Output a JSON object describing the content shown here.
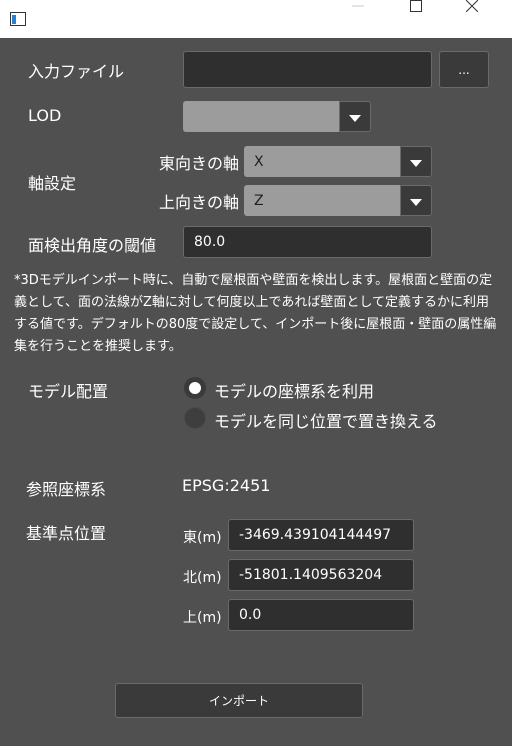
{
  "window": {
    "icons": {
      "app": "app-window-icon",
      "minimize": "minimize-icon",
      "maximize": "maximize-icon",
      "close": "close-icon"
    }
  },
  "input_file": {
    "label": "入力ファイル",
    "value": "",
    "browse_label": "..."
  },
  "lod": {
    "label": "LOD",
    "value": ""
  },
  "axis": {
    "label": "軸設定",
    "east_label": "東向きの軸",
    "east_value": "X",
    "up_label": "上向きの軸",
    "up_value": "Z"
  },
  "face_threshold": {
    "label": "面検出角度の閾値",
    "value": "80.0"
  },
  "note": "*3Dモデルインポート時に、自動で屋根面や壁面を検出します。屋根面と壁面の定義として、面の法線がZ軸に対して何度以上であれば壁面として定義するかに利用する値です。デフォルトの80度で設定して、インポート後に屋根面・壁面の属性編集を行うことを推奨します。",
  "placement": {
    "label": "モデル配置",
    "options": [
      {
        "label": "モデルの座標系を利用",
        "selected": true
      },
      {
        "label": "モデルを同じ位置で置き換える",
        "selected": false
      }
    ]
  },
  "crs": {
    "label": "参照座標系",
    "value": "EPSG:2451"
  },
  "reference_point": {
    "label": "基準点位置",
    "east_label": "東(m)",
    "east_value": "-3469.439104144497",
    "north_label": "北(m)",
    "north_value": "-51801.1409563204",
    "up_label": "上(m)",
    "up_value": "0.0"
  },
  "import_button": "インポート",
  "colors": {
    "background": "#505050",
    "field": "#2f2f2f",
    "combo_value": "#9c9c9c",
    "titlebar": "#ffffff"
  }
}
